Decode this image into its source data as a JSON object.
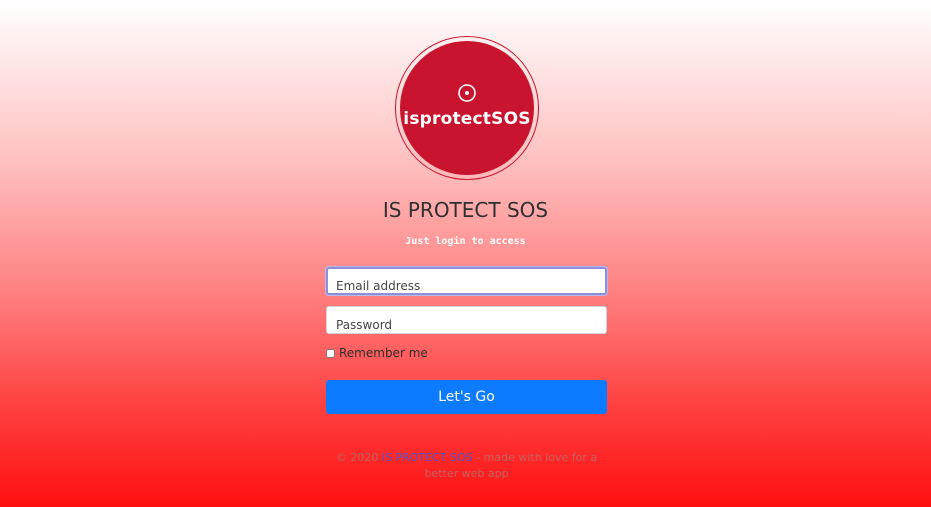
{
  "logo": {
    "text": "isprotectSOS",
    "icon": "target-dot-icon"
  },
  "title": "IS PROTECT SOS",
  "subtitle": "Just login to access",
  "form": {
    "email_placeholder": "Email address",
    "password_placeholder": "Password",
    "remember_label": "Remember me",
    "submit_label": "Let's Go"
  },
  "footer": {
    "prefix": "© 2020 ",
    "link": "IS PROTECT SOS",
    "suffix": " - made with love for a better web app"
  },
  "colors": {
    "brand": "#c8142e",
    "button": "#0d7bff"
  }
}
